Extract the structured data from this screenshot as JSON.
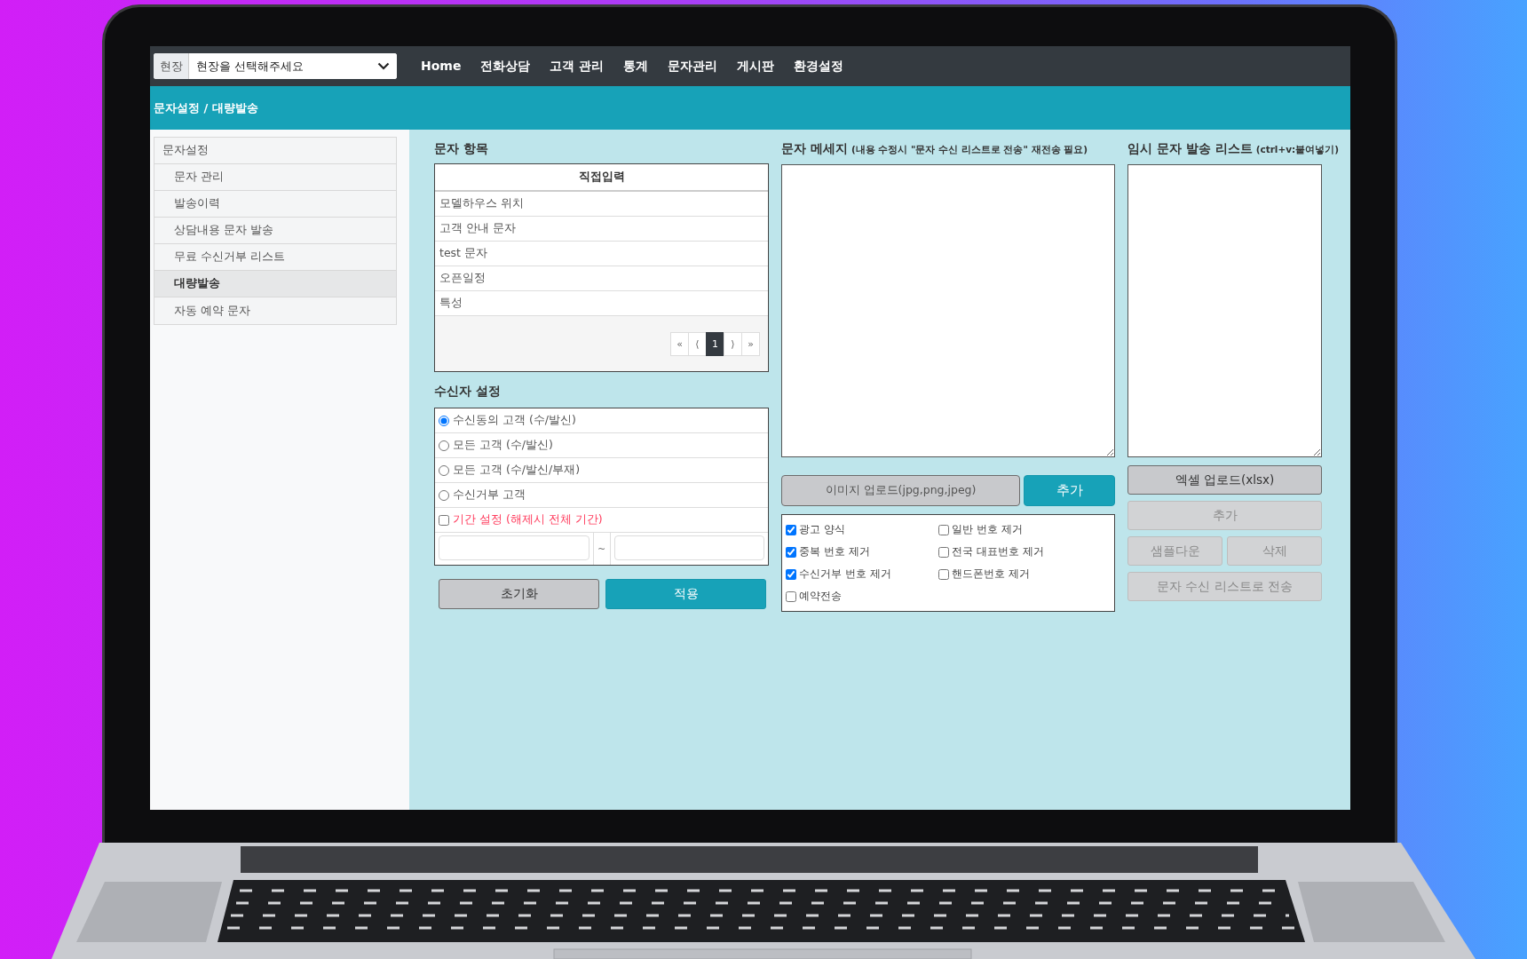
{
  "site_select": {
    "label": "현장",
    "placeholder": "현장을 선택해주세요"
  },
  "nav_links": [
    "Home",
    "전화상담",
    "고객 관리",
    "통계",
    "문자관리",
    "게시판",
    "환경설정"
  ],
  "breadcrumb": "문자설정 / 대량발송",
  "sidebar": {
    "title": "문자설정",
    "items": [
      {
        "label": "문자 관리",
        "selected": false
      },
      {
        "label": "발송이력",
        "selected": false
      },
      {
        "label": "상담내용 문자 발송",
        "selected": false
      },
      {
        "label": "무료 수신거부 리스트",
        "selected": false
      },
      {
        "label": "대량발송",
        "selected": true
      },
      {
        "label": "자동 예약 문자",
        "selected": false
      }
    ]
  },
  "message_items": {
    "title": "문자 항목",
    "header": "직접입력",
    "rows": [
      "모델하우스 위치",
      "고객 안내 문자",
      "test 문자",
      "오픈일정",
      "특성"
    ],
    "pagination": {
      "first": "«",
      "prev": "⟨",
      "pages": [
        {
          "label": "1",
          "selected": true
        }
      ],
      "next": "⟩",
      "last": "»"
    }
  },
  "recipients": {
    "title": "수신자 설정",
    "options": [
      {
        "kind": "radio",
        "label": "수신동의 고객 (수/발신)",
        "selected": true
      },
      {
        "kind": "radio",
        "label": "모든 고객 (수/발신)",
        "selected": false
      },
      {
        "kind": "radio",
        "label": "모든 고객 (수/발신/부재)",
        "selected": false
      },
      {
        "kind": "radio",
        "label": "수신거부 고객",
        "selected": false
      },
      {
        "kind": "checkbox",
        "label": "기간 설정 (해제시 전체 기간)",
        "checked": false
      }
    ],
    "range_separator": "~",
    "buttons": [
      {
        "label": "초기화",
        "primary": false
      },
      {
        "label": "적용",
        "primary": true
      }
    ]
  },
  "message": {
    "title": "문자 메세지",
    "note": "(내용 수정시 \"문자 수신 리스트로 전송\" 재전송 필요)",
    "upload_button": "이미지 업로드(jpg,png,jpeg)",
    "add_button": "추가",
    "options": [
      {
        "label": "광고 양식",
        "checked": true
      },
      {
        "label": "일반 번호 제거",
        "checked": false
      },
      {
        "label": "중복 번호 제거",
        "checked": true
      },
      {
        "label": "전국 대표번호 제거",
        "checked": false
      },
      {
        "label": "수신거부 번호 제거",
        "checked": true
      },
      {
        "label": "핸드폰번호 제거",
        "checked": false
      },
      {
        "label": "예약전송",
        "checked": false
      }
    ]
  },
  "temp_list": {
    "title": "임시 문자 발송 리스트",
    "note": "(ctrl+v:붙여넣기)",
    "buttons": [
      {
        "kind": "wide",
        "label": "엑셀 업로드(xlsx)",
        "disabled": false
      },
      {
        "kind": "wide",
        "label": "추가",
        "disabled": true
      },
      {
        "kind": "half",
        "label": "샘플다운",
        "disabled": true
      },
      {
        "kind": "half",
        "label": "삭제",
        "disabled": true
      },
      {
        "kind": "wide",
        "label": "문자 수신 리스트로 전송",
        "disabled": true
      }
    ]
  }
}
